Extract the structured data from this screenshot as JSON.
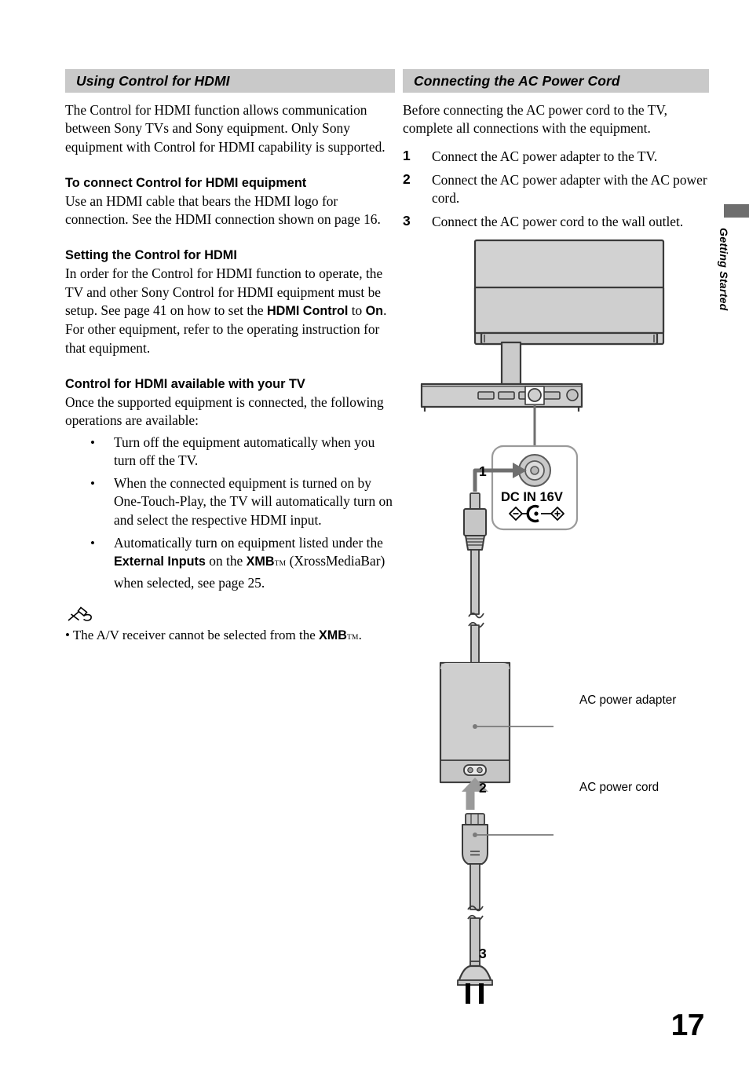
{
  "page_number": "17",
  "side_tab": {
    "label": "Getting Started"
  },
  "left_column": {
    "section_title": "Using Control for HDMI",
    "intro": "The Control for HDMI function allows communication between Sony TVs and Sony equipment. Only Sony equipment with Control for HDMI capability is supported.",
    "sub1": {
      "heading": "To connect Control for HDMI equipment",
      "body": "Use an HDMI cable that bears the HDMI logo for connection. See the HDMI connection shown on page 16."
    },
    "sub2": {
      "heading": "Setting the Control for HDMI",
      "body_part1": "In order for the Control for HDMI function to operate, the TV and other Sony Control for HDMI equipment must be setup. See page 41 on how to set the ",
      "bold1": "HDMI Control",
      "body_part2": " to ",
      "bold2": "On",
      "body_part3": ". For other equipment, refer to the operating instruction for that equipment."
    },
    "sub3": {
      "heading": "Control for HDMI available with your TV",
      "body": "Once the supported equipment is connected, the following operations are available:",
      "bullets": [
        {
          "text": "Turn off the equipment automatically when you turn off the TV."
        },
        {
          "text": "When the connected equipment is turned on by One-Touch-Play, the TV will automatically turn on and select the respective HDMI input."
        },
        {
          "part1": "Automatically turn on equipment listed under the ",
          "bold1": "External Inputs",
          "part2": " on the ",
          "bold2": "XMB",
          "tm": "TM",
          "part3": " (XrossMediaBar) when selected, see page 25."
        }
      ]
    },
    "note": {
      "icon": "pencil-note-icon",
      "part1": "• The A/V receiver cannot be selected from the ",
      "bold1": "XMB",
      "tm": "TM",
      "part2": "."
    }
  },
  "right_column": {
    "section_title": "Connecting the AC Power Cord",
    "intro": "Before connecting the AC power cord to the TV, complete all connections with the equipment.",
    "steps": [
      {
        "num": "1",
        "text": "Connect the AC power adapter to the TV."
      },
      {
        "num": "2",
        "text": "Connect the AC power adapter with the AC power cord."
      },
      {
        "num": "3",
        "text": "Connect the AC power cord to the wall outlet."
      }
    ]
  },
  "figure": {
    "callout_jack_label": "DC IN 16V",
    "polarity_minus": "−",
    "polarity_plus": "+",
    "marker_1": "1",
    "marker_2": "2",
    "marker_3": "3",
    "label_adapter": "AC power adapter",
    "label_cord": "AC power cord"
  },
  "colors": {
    "band_bg": "#c9c9c9",
    "tab_bg": "#6e6e6e",
    "device_fill": "#d2d2d2",
    "device_stroke": "#3a3a3a",
    "cable_fill": "#c6c6c6"
  }
}
